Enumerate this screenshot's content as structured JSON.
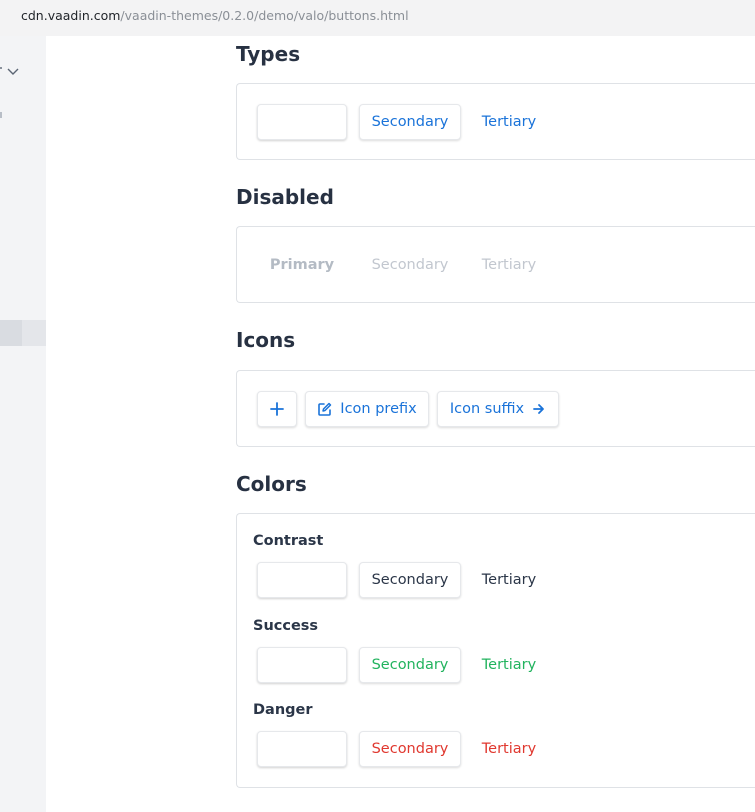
{
  "browser": {
    "url_host": "cdn.vaadin.com",
    "url_path": "/vaadin-themes/0.2.0/demo/valo/buttons.html"
  },
  "colors": {
    "blue": "#1a73d9",
    "disabled": "#b4bbc4",
    "contrast": "#2b3648",
    "success": "#22b35e",
    "danger": "#e0382f"
  },
  "types": {
    "heading": "Types",
    "primary": "",
    "secondary": "Secondary",
    "tertiary": "Tertiary"
  },
  "disabled": {
    "heading": "Disabled",
    "primary": "Primary",
    "secondary": "Secondary",
    "tertiary": "Tertiary"
  },
  "icons": {
    "heading": "Icons",
    "plus_icon": "plus-icon",
    "prefix_label": "Icon prefix",
    "prefix_icon": "edit-icon",
    "suffix_label": "Icon suffix",
    "suffix_icon": "arrow-right-icon"
  },
  "colors_section": {
    "heading": "Colors",
    "groups": [
      {
        "label": "Contrast",
        "primary": "",
        "secondary": "Secondary",
        "tertiary": "Tertiary"
      },
      {
        "label": "Success",
        "primary": "",
        "secondary": "Secondary",
        "tertiary": "Tertiary"
      },
      {
        "label": "Danger",
        "primary": "",
        "secondary": "Secondary",
        "tertiary": "Tertiary"
      }
    ]
  }
}
